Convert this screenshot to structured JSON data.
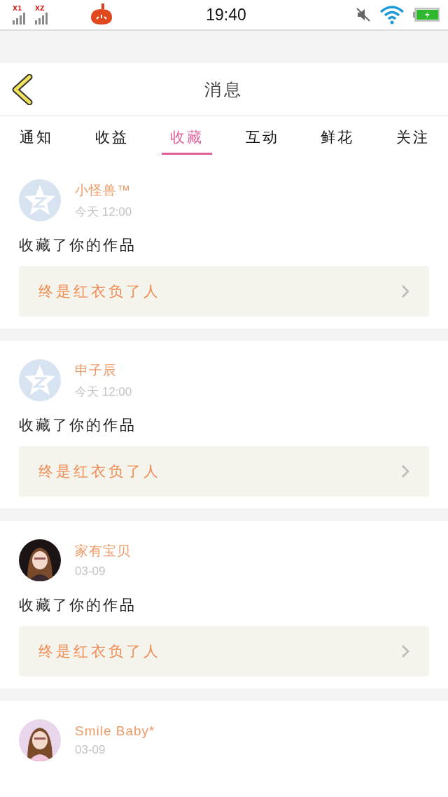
{
  "status_bar": {
    "sim_labels": [
      "X1",
      "XZ"
    ],
    "time": "19:40"
  },
  "header": {
    "title": "消息"
  },
  "tabs": [
    {
      "label": "通知",
      "selected": false
    },
    {
      "label": "收益",
      "selected": false
    },
    {
      "label": "收藏",
      "selected": true
    },
    {
      "label": "互动",
      "selected": false
    },
    {
      "label": "鲜花",
      "selected": false
    },
    {
      "label": "关注",
      "selected": false
    }
  ],
  "messages": [
    {
      "name": "小怪兽™",
      "time": "今天 12:00",
      "avatar": {
        "kind": "default"
      },
      "text": "收藏了你的作品",
      "work": "终是红衣负了人"
    },
    {
      "name": "申子辰",
      "time": "今天 12:00",
      "avatar": {
        "kind": "default"
      },
      "text": "收藏了你的作品",
      "work": "终是红衣负了人"
    },
    {
      "name": "家有宝贝",
      "time": "03-09",
      "text": "收藏了你的作品",
      "work": "终是红衣负了人"
    },
    {
      "name": "Smile Baby*",
      "time": "03-09"
    }
  ]
}
